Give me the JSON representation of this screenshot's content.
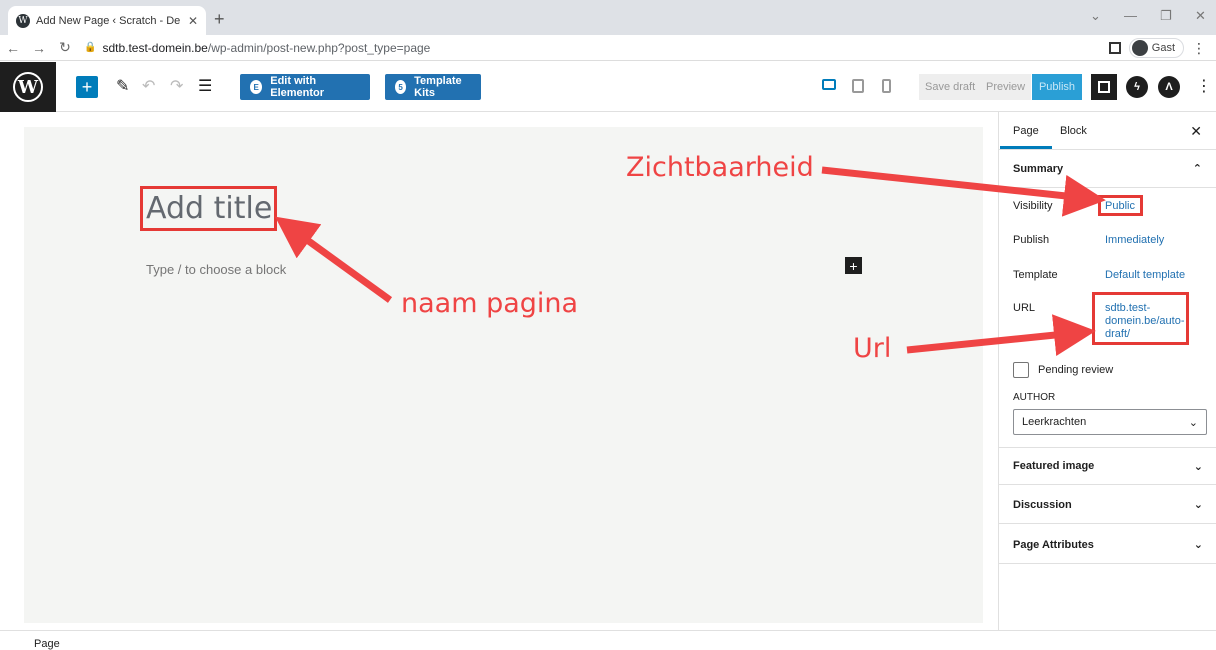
{
  "browser": {
    "tab_title": "Add New Page ‹ Scratch - De Tov",
    "favicon": "W",
    "url_host": "sdtb.test-domein.be",
    "url_path": "/wp-admin/post-new.php?post_type=page",
    "profile_name": "Gast"
  },
  "toolbar": {
    "wp_logo": "W",
    "edit_elementor": "Edit with Elementor",
    "elementor_icon": "E",
    "template_kits": "Template Kits",
    "template_kits_icon": "5",
    "save_draft": "Save draft",
    "preview": "Preview",
    "publish": "Publish"
  },
  "editor": {
    "title_placeholder": "Add title",
    "block_placeholder": "Type / to choose a block"
  },
  "sidebar": {
    "tab_page": "Page",
    "tab_block": "Block",
    "summary": "Summary",
    "visibility_label": "Visibility",
    "visibility_value": "Public",
    "publish_label": "Publish",
    "publish_value": "Immediately",
    "template_label": "Template",
    "template_value": "Default template",
    "url_label": "URL",
    "url_line1": "sdtb.test-",
    "url_line2": "domein.be/auto-",
    "url_line3": "draft/",
    "pending_review": "Pending review",
    "author_label": "AUTHOR",
    "author_value": "Leerkrachten",
    "featured_image": "Featured image",
    "discussion": "Discussion",
    "page_attributes": "Page Attributes"
  },
  "footer": {
    "breadcrumb": "Page"
  },
  "annotations": {
    "zichtbaarheid": "Zichtbaarheid",
    "naam_pagina": "naam pagina",
    "url": "Url"
  },
  "colors": {
    "accent": "#007cba",
    "annotation": "#ef4444"
  }
}
